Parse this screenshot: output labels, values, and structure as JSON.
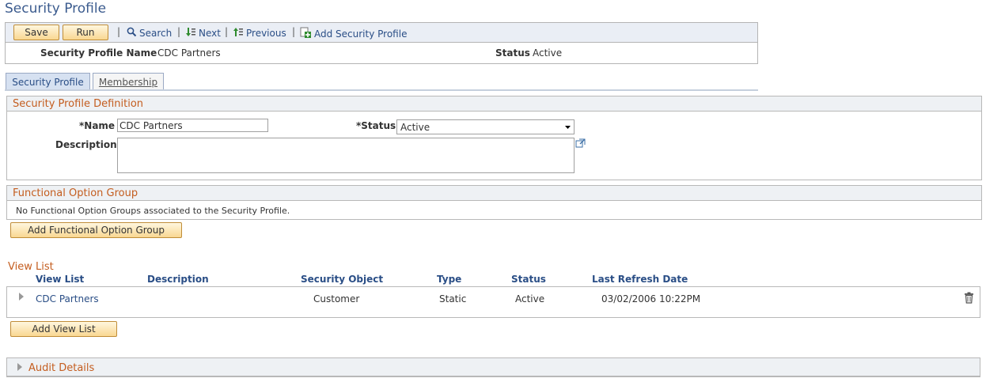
{
  "page": {
    "title": "Security Profile"
  },
  "toolbar": {
    "save_label": "Save",
    "run_label": "Run",
    "separator": "|",
    "search_label": "Search",
    "next_label": "Next",
    "previous_label": "Previous",
    "add_label": "Add Security Profile"
  },
  "header": {
    "name_label": "Security Profile Name",
    "name_value": "CDC Partners",
    "status_label": "Status",
    "status_value": "Active"
  },
  "tabs": [
    {
      "label": "Security Profile",
      "active": true
    },
    {
      "label": "Membership",
      "active": false
    }
  ],
  "definition": {
    "title": "Security Profile Definition",
    "name_label": "*Name",
    "name_value": "CDC Partners",
    "status_label": "*Status",
    "status_value": "Active",
    "description_label": "Description",
    "description_value": ""
  },
  "functional": {
    "title": "Functional Option Group",
    "empty_text": "No Functional Option Groups associated to the Security Profile.",
    "add_label": "Add Functional Option Group"
  },
  "view_list": {
    "title": "View List",
    "columns": [
      "View List",
      "Description",
      "Security Object",
      "Type",
      "Status",
      "Last Refresh Date"
    ],
    "rows": [
      {
        "view_list": "CDC Partners",
        "description": "",
        "security_object": "Customer",
        "type": "Static",
        "status": "Active",
        "last_refresh": "03/02/2006 10:22PM"
      }
    ],
    "add_label": "Add View List"
  },
  "audit": {
    "title": "Audit Details"
  },
  "colors": {
    "accent": "#2a4e86",
    "section_title": "#c45d1f",
    "button": "#f9d792"
  },
  "icons": [
    "search-icon",
    "next-icon",
    "previous-icon",
    "add-icon",
    "expand-icon",
    "delete-icon",
    "popup-icon",
    "chevron-down-icon"
  ]
}
